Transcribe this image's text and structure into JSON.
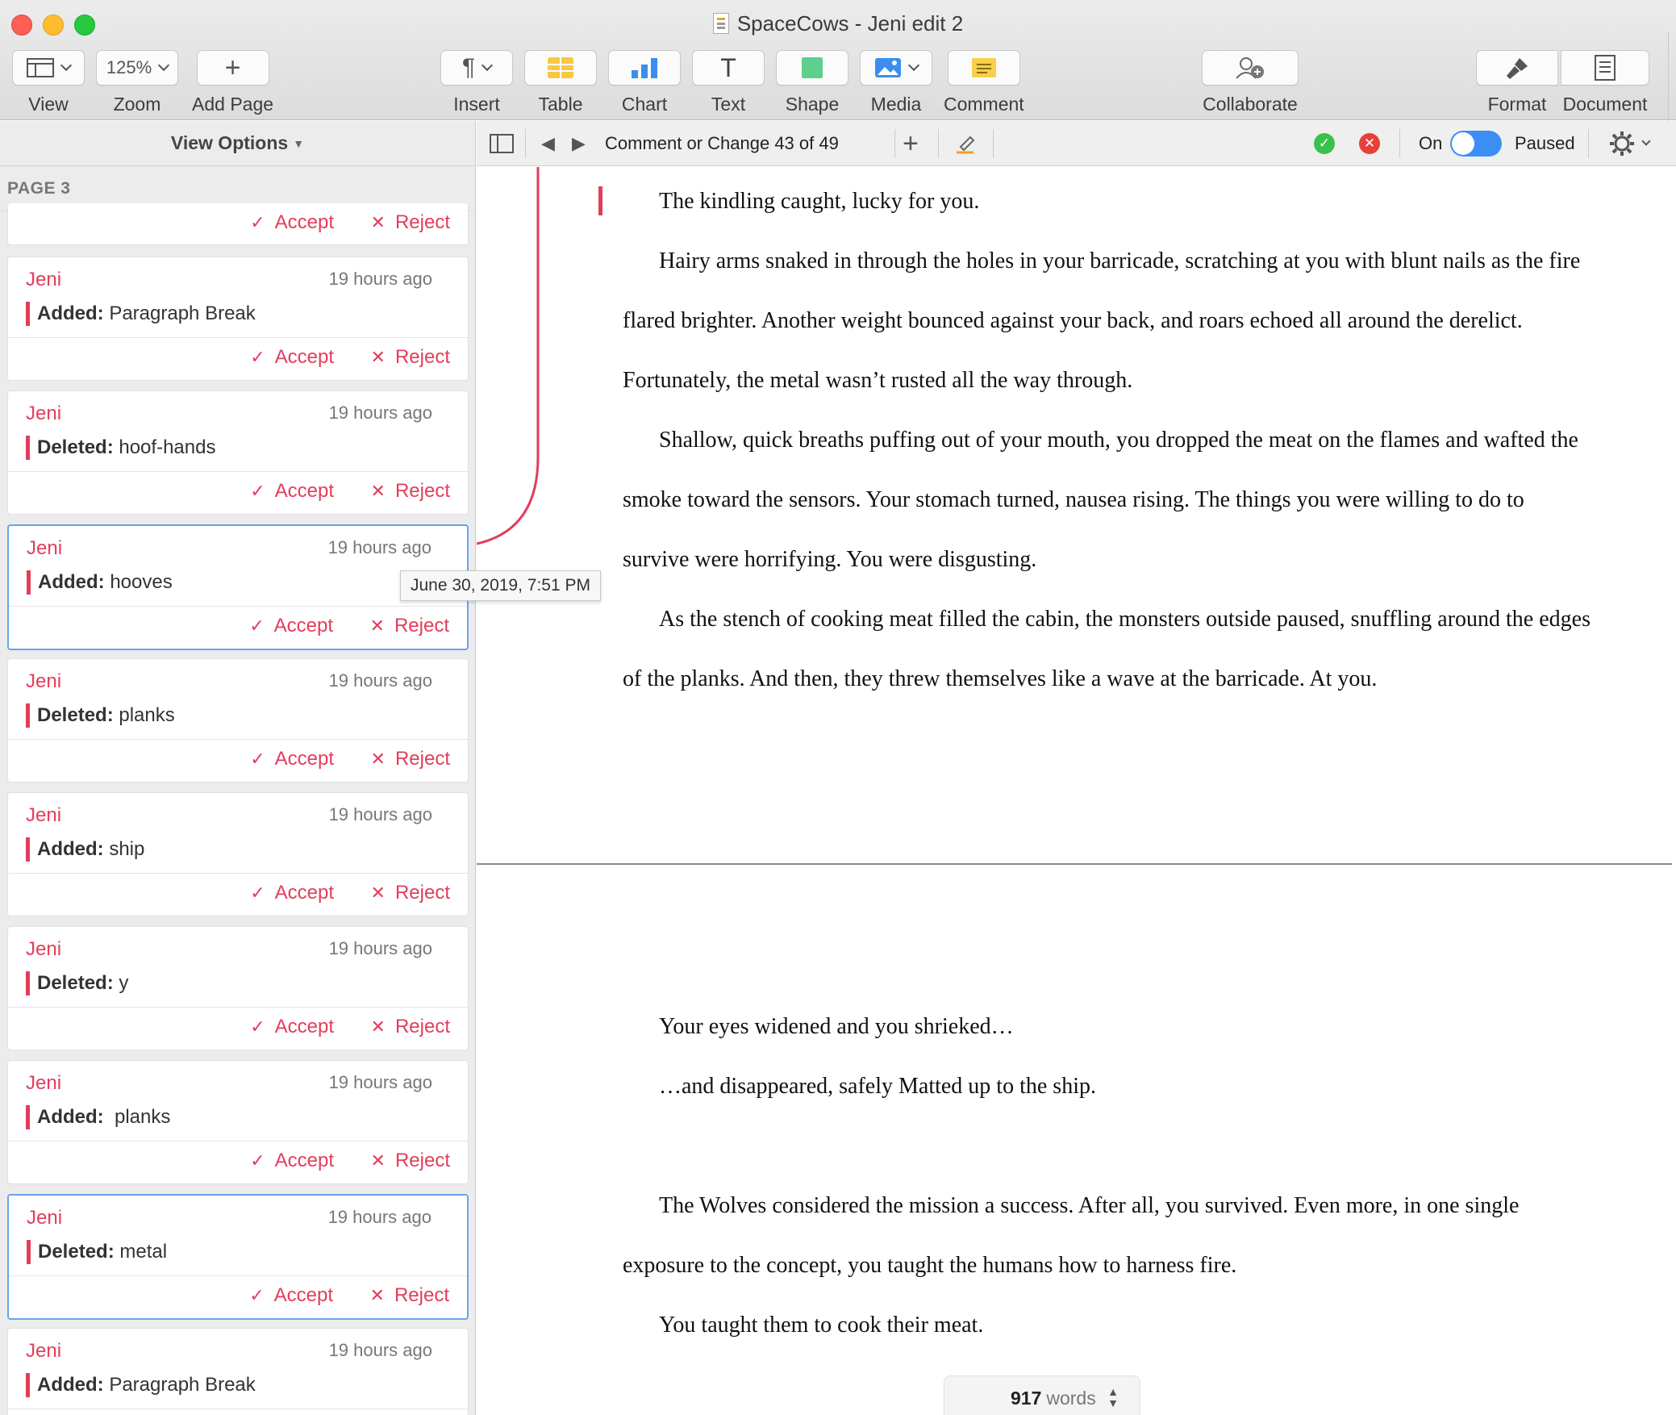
{
  "window": {
    "title": "SpaceCows - Jeni edit 2"
  },
  "toolbar": {
    "view": "View",
    "zoom_value": "125%",
    "zoom": "Zoom",
    "add_page": "Add Page",
    "insert": "Insert",
    "table": "Table",
    "chart": "Chart",
    "text": "Text",
    "shape": "Shape",
    "media": "Media",
    "comment": "Comment",
    "collaborate": "Collaborate",
    "format": "Format",
    "document": "Document"
  },
  "sidebar": {
    "view_options": "View Options",
    "page_label": "PAGE 3",
    "tooltip": "June 30, 2019, 7:51 PM",
    "accept": "Accept",
    "reject": "Reject",
    "changes": [
      {
        "author": "Jeni",
        "time": "19 hours ago",
        "kind": "Added:",
        "text": "Paragraph Break"
      },
      {
        "author": "Jeni",
        "time": "19 hours ago",
        "kind": "Deleted:",
        "text": "hoof-hands"
      },
      {
        "author": "Jeni",
        "time": "19 hours ago",
        "kind": "Added:",
        "text": "hooves"
      },
      {
        "author": "Jeni",
        "time": "19 hours ago",
        "kind": "Deleted:",
        "text": "planks"
      },
      {
        "author": "Jeni",
        "time": "19 hours ago",
        "kind": "Added:",
        "text": "ship"
      },
      {
        "author": "Jeni",
        "time": "19 hours ago",
        "kind": "Deleted:",
        "text": "y"
      },
      {
        "author": "Jeni",
        "time": "19 hours ago",
        "kind": "Added:",
        "text": " planks"
      },
      {
        "author": "Jeni",
        "time": "19 hours ago",
        "kind": "Deleted:",
        "text": "metal"
      },
      {
        "author": "Jeni",
        "time": "19 hours ago",
        "kind": "Added:",
        "text": "Paragraph Break"
      }
    ]
  },
  "reviewbar": {
    "position": "Comment or Change 43 of 49",
    "tracking_label": "On",
    "status": "Paused"
  },
  "document": {
    "paragraphs": [
      "The kindling caught, lucky for you.",
      "Hairy arms snaked in through the holes in your barricade, scratching at you with blunt nails as the fire flared brighter. Another weight bounced against your back, and roars echoed all around the derelict. Fortunately, the metal wasn’t rusted all the way through.",
      "Shallow, quick breaths puffing out of your mouth, you dropped the meat on the flames and wafted the smoke toward the sensors. Your stomach turned, nausea rising. The things you were willing to do to survive were horrifying. You were disgusting.",
      "As the stench of cooking meat filled the cabin, the monsters outside paused, snuffling around the edges of the planks. And then, they threw themselves like a wave at the barricade. At you.",
      "Your eyes widened and you shrieked…",
      "…and disappeared, safely Matted up to the ship.",
      "The Wolves considered the mission a success. After all, you survived. Even more, in one single exposure to the concept, you taught the humans how to harness fire.",
      "You taught them to cook their meat."
    ],
    "word_count": "917",
    "word_count_label": "words"
  },
  "colors": {
    "accent_red": "#e33d5b",
    "selection_blue": "#6aa2ee",
    "toggle_blue": "#3b8ff4"
  }
}
